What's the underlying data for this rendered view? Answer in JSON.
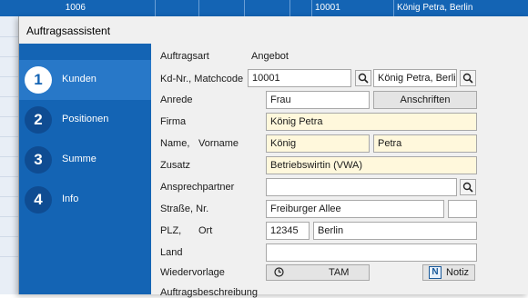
{
  "background_row": {
    "col1": "1006",
    "col2": "10001",
    "col3": "König Petra, Berlin"
  },
  "dialog": {
    "title": "Auftragsassistent"
  },
  "steps": [
    {
      "number": "1",
      "label": "Kunden"
    },
    {
      "number": "2",
      "label": "Positionen"
    },
    {
      "number": "3",
      "label": "Summe"
    },
    {
      "number": "4",
      "label": "Info"
    }
  ],
  "form": {
    "auftragsart_label": "Auftragsart",
    "auftragsart_value": "Angebot",
    "kdnr_label": "Kd-Nr., Matchcode",
    "kdnr_value": "10001",
    "matchcode_value": "König Petra, Berlin",
    "anrede_label": "Anrede",
    "anrede_value": "Frau",
    "anschriften_button": "Anschriften",
    "firma_label": "Firma",
    "firma_value": "König Petra",
    "name_label": "Name,",
    "vorname_label": "Vorname",
    "name_value": "König",
    "vorname_value": "Petra",
    "zusatz_label": "Zusatz",
    "zusatz_value": "Betriebswirtin (VWA)",
    "ansprechpartner_label": "Ansprechpartner",
    "ansprechpartner_value": "",
    "strasse_label": "Straße, Nr.",
    "strasse_value": "Freiburger Allee",
    "nr_value": "",
    "plz_label": "PLZ,",
    "ort_label": "Ort",
    "plz_value": "12345",
    "ort_value": "Berlin",
    "land_label": "Land",
    "land_value": "",
    "wiedervorlage_label": "Wiedervorlage",
    "tam_button": "TAM",
    "notiz_button": "Notiz",
    "auftragsbeschreibung_label": "Auftragsbeschreibung"
  },
  "colors": {
    "accent": "#1464b4",
    "active_step": "#2878c8",
    "highlight_field": "#fff8dc"
  }
}
